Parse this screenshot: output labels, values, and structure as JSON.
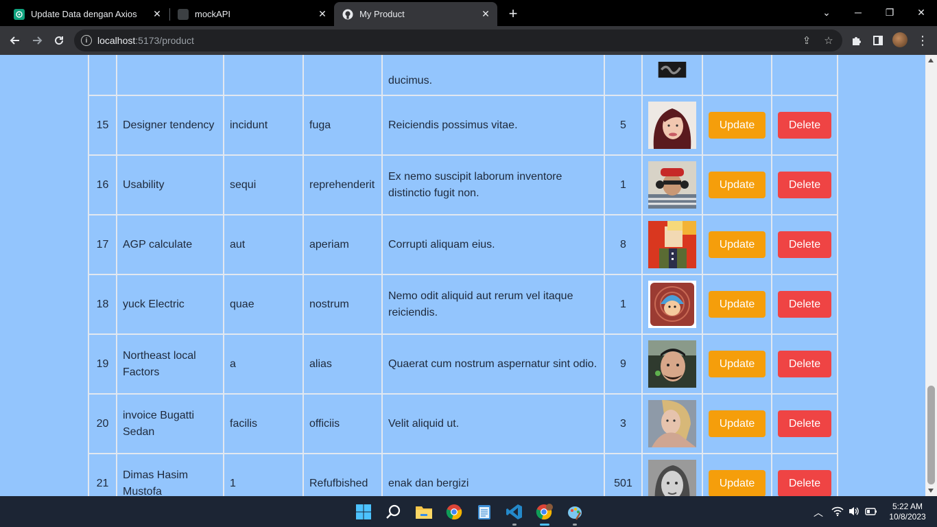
{
  "browser": {
    "tabs": [
      {
        "title": "Update Data dengan Axios",
        "icon": "chatgpt-icon",
        "active": false
      },
      {
        "title": "mockAPI",
        "icon": "mockapi-icon",
        "active": false
      },
      {
        "title": "My Product",
        "icon": "github-icon",
        "active": true
      }
    ],
    "url_host": "localhost",
    "url_rest": ":5173/product"
  },
  "products": {
    "partial_row": {
      "description_tail": "ducimus."
    },
    "rows": [
      {
        "id": "15",
        "name": "Designer tendency",
        "material": "incidunt",
        "category": "fuga",
        "description": "Reiciendis possimus vitae.",
        "qty": "5",
        "image": "avatar-woman-red-hair"
      },
      {
        "id": "16",
        "name": "Usability",
        "material": "sequi",
        "category": "reprehenderit",
        "description": "Ex nemo suscipit laborum inventore distinctio fugit non.",
        "qty": "1",
        "image": "avatar-man-headphones"
      },
      {
        "id": "17",
        "name": "AGP calculate",
        "material": "aut",
        "category": "aperiam",
        "description": "Corrupti aliquam eius.",
        "qty": "8",
        "image": "avatar-pixel-art"
      },
      {
        "id": "18",
        "name": "yuck Electric",
        "material": "quae",
        "category": "nostrum",
        "description": "Nemo odit aliquid aut rerum vel itaque reiciendis.",
        "qty": "1",
        "image": "avatar-cartoon"
      },
      {
        "id": "19",
        "name": "Northeast local Factors",
        "material": "a",
        "category": "alias",
        "description": "Quaerat cum nostrum aspernatur sint odio.",
        "qty": "9",
        "image": "avatar-man-car"
      },
      {
        "id": "20",
        "name": "invoice Bugatti Sedan",
        "material": "facilis",
        "category": "officiis",
        "description": "Velit aliquid ut.",
        "qty": "3",
        "image": "avatar-woman-blonde"
      },
      {
        "id": "21",
        "name": "Dimas Hasim Mustofa",
        "material": "1",
        "category": "Refufbished",
        "description": "enak dan bergizi",
        "qty": "501",
        "image": "avatar-man-bw"
      }
    ],
    "update_label": "Update",
    "delete_label": "Delete"
  },
  "taskbar": {
    "time": "5:22 AM",
    "date": "10/8/2023"
  }
}
